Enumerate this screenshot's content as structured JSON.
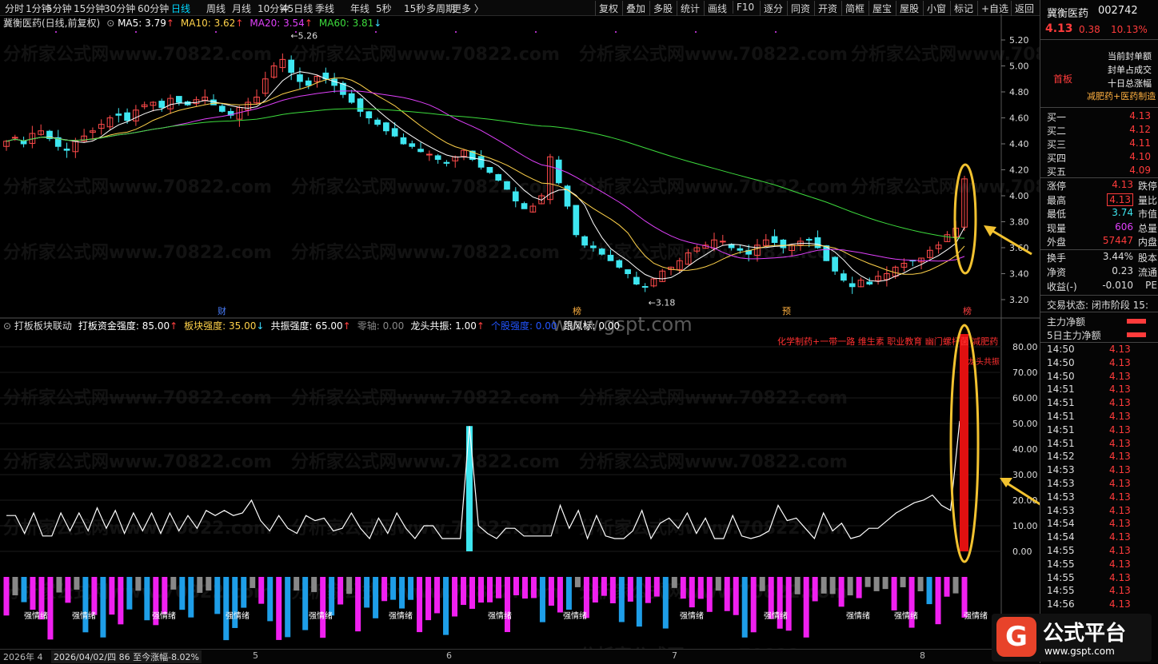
{
  "toolbar": {
    "periods": [
      "分时",
      "1分钟",
      "5分钟",
      "15分钟",
      "30分钟",
      "60分钟",
      "日线",
      "周线",
      "月线",
      "10分钟",
      "45日线",
      "季线",
      "年线",
      "5秒",
      "15秒",
      "多周期",
      "更多 〉"
    ],
    "active_period": "日线",
    "buttons": [
      "复权",
      "叠加",
      "多股",
      "统计",
      "画线",
      "F10",
      "逐分",
      "同资",
      "开资",
      "简框",
      "屋宝",
      "屋股",
      "小窗",
      "标记",
      "+自选",
      "返回"
    ]
  },
  "chart_header": {
    "title": "冀衡医药(日线,前复权)",
    "ma": [
      {
        "label": "MA5: 3.79",
        "arrow": "↑",
        "color": "#ffffff"
      },
      {
        "label": "MA10: 3.62",
        "arrow": "↑",
        "color": "#ffd24a"
      },
      {
        "label": "MA20: 3.54",
        "arrow": "↑",
        "color": "#e040fb"
      },
      {
        "label": "MA60: 3.81",
        "arrow": "↓",
        "color": "#3ddc3d"
      }
    ]
  },
  "price_axis": [
    "5.20",
    "5.00",
    "4.80",
    "4.60",
    "4.40",
    "4.20",
    "4.00",
    "3.80",
    "3.60",
    "3.40",
    "3.20"
  ],
  "price_marks": {
    "high": "5.26",
    "low": "3.18"
  },
  "event_marks": [
    "财",
    "榜",
    "预",
    "榜"
  ],
  "indicator_header": {
    "title": "打板板块联动",
    "items": [
      {
        "label": "打板资金强度: 85.00",
        "arrow": "↑",
        "color": "#ffffff"
      },
      {
        "label": "板块强度: 35.00",
        "arrow": "↓",
        "color": "#ffd24a"
      },
      {
        "label": "共振强度: 65.00",
        "arrow": "↑",
        "color": "#ffffff"
      },
      {
        "label": "零轴: 0.00",
        "arrow": "",
        "color": "#888888"
      },
      {
        "label": "龙头共振: 1.00",
        "arrow": "↑",
        "color": "#ffffff"
      },
      {
        "label": "个股强度: 0.00",
        "arrow": "",
        "color": "#2255ff"
      },
      {
        "label": "跟风标: 0.00",
        "arrow": "",
        "color": "#ffffff"
      }
    ]
  },
  "indicator_axis": [
    "80.00",
    "70.00",
    "60.00",
    "50.00",
    "40.00",
    "30.00",
    "20.00",
    "10.00",
    "0.00"
  ],
  "sector_tags": "化学制药+一带一路 维生素 职业教育 幽门螺杆菌 减肥药",
  "dragon_tag": "龙头共振",
  "emotion_label": "强情绪",
  "watermarks": {
    "main": "分析家公式网www.70822.com",
    "site": "www.gspt.com"
  },
  "bottom": {
    "year": "2026年 4",
    "cursor": "2026/04/02/四 86 至今涨幅-8.02%",
    "months": [
      "5",
      "6",
      "7",
      "8"
    ]
  },
  "right_panel": {
    "name": "冀衡医药",
    "code": "002742",
    "price": "4.13",
    "change": "0.38",
    "pct": "10.13%",
    "board_tag": "首板",
    "info_lines": [
      "当前封单额",
      "封单占成交",
      "十日总涨幅",
      "减肥药+医药制造"
    ],
    "order_book": [
      {
        "k": "买一",
        "v": "4.13"
      },
      {
        "k": "买二",
        "v": "4.12"
      },
      {
        "k": "买三",
        "v": "4.11"
      },
      {
        "k": "买四",
        "v": "4.10"
      },
      {
        "k": "买五",
        "v": "4.09"
      }
    ],
    "stats": [
      {
        "k": "涨停",
        "v": "4.13",
        "k2": "跌停"
      },
      {
        "k": "最高",
        "v": "4.13",
        "k2": "量比"
      },
      {
        "k": "最低",
        "v": "3.74",
        "k2": "市值"
      },
      {
        "k": "现量",
        "v": "606",
        "k2": "总量"
      },
      {
        "k": "外盘",
        "v": "57447",
        "k2": "内盘"
      }
    ],
    "stats2": [
      {
        "k": "换手",
        "v": "3.44%",
        "k2": "股本"
      },
      {
        "k": "净资",
        "v": "0.23",
        "k2": "流通"
      },
      {
        "k": "收益(-)",
        "v": "-0.010",
        "k2": "PE"
      }
    ],
    "trade_status": "交易状态: 闭市阶段 15:",
    "flows": [
      "主力净额",
      "5日主力净额"
    ],
    "ticks": [
      {
        "t": "14:50",
        "p": "4.13"
      },
      {
        "t": "14:50",
        "p": "4.13"
      },
      {
        "t": "14:50",
        "p": "4.13"
      },
      {
        "t": "14:51",
        "p": "4.13"
      },
      {
        "t": "14:51",
        "p": "4.13"
      },
      {
        "t": "14:51",
        "p": "4.13"
      },
      {
        "t": "14:51",
        "p": "4.13"
      },
      {
        "t": "14:51",
        "p": "4.13"
      },
      {
        "t": "14:52",
        "p": "4.13"
      },
      {
        "t": "14:53",
        "p": "4.13"
      },
      {
        "t": "14:53",
        "p": "4.13"
      },
      {
        "t": "14:53",
        "p": "4.13"
      },
      {
        "t": "14:53",
        "p": "4.13"
      },
      {
        "t": "14:54",
        "p": "4.13"
      },
      {
        "t": "14:54",
        "p": "4.13"
      },
      {
        "t": "14:55",
        "p": "4.13"
      },
      {
        "t": "14:55",
        "p": "4.13"
      },
      {
        "t": "14:55",
        "p": "4.13"
      },
      {
        "t": "14:55",
        "p": "4.13"
      },
      {
        "t": "14:56",
        "p": "4.13"
      },
      {
        "t": "14:56",
        "p": "4.13"
      }
    ],
    "logo": "公式平台",
    "logo_url": "www.gspt.com"
  },
  "series": {
    "closes": [
      4.42,
      4.45,
      4.4,
      4.48,
      4.5,
      4.44,
      4.38,
      4.35,
      4.42,
      4.46,
      4.5,
      4.55,
      4.6,
      4.62,
      4.58,
      4.66,
      4.7,
      4.72,
      4.68,
      4.75,
      4.72,
      4.7,
      4.74,
      4.76,
      4.7,
      4.65,
      4.62,
      4.68,
      4.72,
      4.76,
      4.9,
      5.0,
      5.05,
      4.95,
      4.88,
      4.85,
      4.92,
      4.9,
      4.85,
      4.78,
      4.72,
      4.65,
      4.6,
      4.55,
      4.5,
      4.46,
      4.4,
      4.38,
      4.34,
      4.32,
      4.28,
      4.25,
      4.3,
      4.35,
      4.28,
      4.22,
      4.18,
      4.12,
      4.05,
      3.96,
      3.9,
      3.92,
      4.0,
      4.3,
      4.1,
      3.92,
      3.7,
      3.62,
      3.6,
      3.55,
      3.5,
      3.45,
      3.4,
      3.32,
      3.3,
      3.36,
      3.42,
      3.45,
      3.5,
      3.56,
      3.6,
      3.62,
      3.66,
      3.65,
      3.6,
      3.58,
      3.55,
      3.62,
      3.66,
      3.64,
      3.6,
      3.62,
      3.65,
      3.66,
      3.6,
      3.5,
      3.42,
      3.35,
      3.3,
      3.35,
      3.32,
      3.38,
      3.4,
      3.45,
      3.48,
      3.5,
      3.52,
      3.58,
      3.62,
      3.7,
      3.75,
      4.13
    ],
    "line": [
      14,
      14,
      7,
      15,
      6,
      6,
      15,
      8,
      15,
      8,
      17,
      9,
      16,
      7,
      15,
      8,
      15,
      7,
      15,
      8,
      14,
      9,
      16,
      14,
      16,
      14,
      15,
      20,
      12,
      8,
      14,
      9,
      7,
      14,
      12,
      13,
      8,
      9,
      15,
      9,
      5,
      13,
      7,
      15,
      9,
      5,
      10,
      10,
      5,
      5,
      5,
      49,
      10,
      7,
      5,
      9,
      9,
      6,
      6,
      6,
      6,
      18,
      9,
      16,
      5,
      14,
      6,
      5,
      5,
      8,
      16,
      5,
      11,
      13,
      9,
      15,
      7,
      13,
      5,
      5,
      14,
      6,
      5,
      6,
      8,
      18,
      12,
      13,
      9,
      5,
      15,
      8,
      11,
      5,
      6,
      9,
      9,
      12,
      15,
      17,
      19,
      20,
      22,
      18,
      16,
      51
    ],
    "red_bar_value": 85
  }
}
